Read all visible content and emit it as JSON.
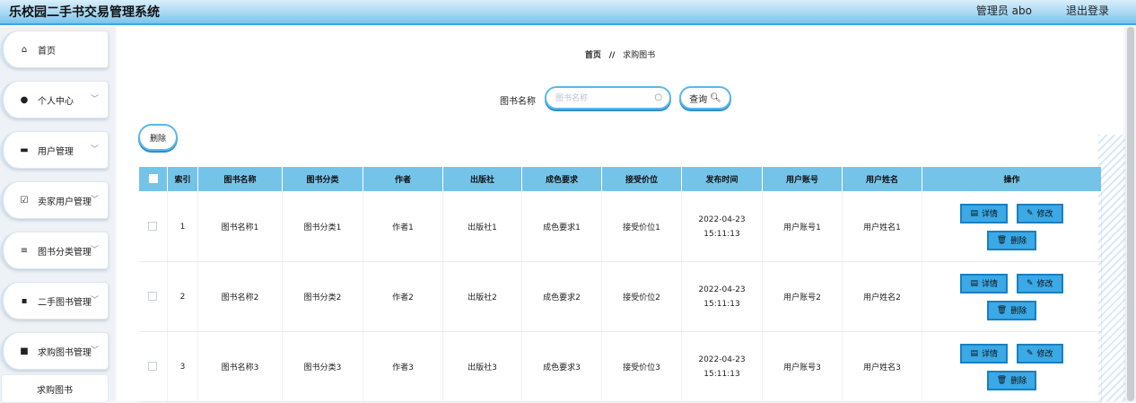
{
  "header": {
    "app_title": "乐校园二手书交易管理系统",
    "admin_label": "管理员 abo",
    "logout_label": "退出登录"
  },
  "sidebar": {
    "items": [
      {
        "label": "首页",
        "icon": "home-icon",
        "glyph": "⌂",
        "has_chevron": false
      },
      {
        "label": "个人中心",
        "icon": "user-icon",
        "glyph": "●",
        "has_chevron": true
      },
      {
        "label": "用户管理",
        "icon": "monitor-icon",
        "glyph": "▬",
        "has_chevron": true
      },
      {
        "label": "卖家用户管理",
        "icon": "check-square-icon",
        "glyph": "☑",
        "has_chevron": true
      },
      {
        "label": "图书分类管理",
        "icon": "list-icon",
        "glyph": "≡",
        "has_chevron": true
      },
      {
        "label": "二手图书管理",
        "icon": "grid-icon",
        "glyph": "▪",
        "has_chevron": true
      },
      {
        "label": "求购图书管理",
        "icon": "book-icon",
        "glyph": "■",
        "has_chevron": true
      }
    ],
    "sub_item": "求购图书"
  },
  "breadcrumb": {
    "home": "首页",
    "separator": "//",
    "current": "求购图书"
  },
  "search": {
    "label": "图书名称",
    "placeholder": "图书名称",
    "value": "",
    "query_label": "查询"
  },
  "toolbar": {
    "delete_label": "删除"
  },
  "table": {
    "columns": [
      "索引",
      "图书名称",
      "图书分类",
      "作者",
      "出版社",
      "成色要求",
      "接受价位",
      "发布时间",
      "用户账号",
      "用户姓名",
      "操作"
    ],
    "rows": [
      {
        "index": "1",
        "name": "图书名称1",
        "category": "图书分类1",
        "author": "作者1",
        "publisher": "出版社1",
        "condition": "成色要求1",
        "price": "接受价位1",
        "time": "2022-04-23 15:11:13",
        "account": "用户账号1",
        "username": "用户姓名1"
      },
      {
        "index": "2",
        "name": "图书名称2",
        "category": "图书分类2",
        "author": "作者2",
        "publisher": "出版社2",
        "condition": "成色要求2",
        "price": "接受价位2",
        "time": "2022-04-23 15:11:13",
        "account": "用户账号2",
        "username": "用户姓名2"
      },
      {
        "index": "3",
        "name": "图书名称3",
        "category": "图书分类3",
        "author": "作者3",
        "publisher": "出版社3",
        "condition": "成色要求3",
        "price": "接受价位3",
        "time": "2022-04-23 15:11:13",
        "account": "用户账号3",
        "username": "用户姓名3"
      }
    ],
    "actions": {
      "detail": "详情",
      "edit": "修改",
      "delete": "删除"
    }
  },
  "colors": {
    "accent": "#3aa9e6",
    "header_bg": "#74c4ea",
    "border": "#1a7fc0"
  }
}
